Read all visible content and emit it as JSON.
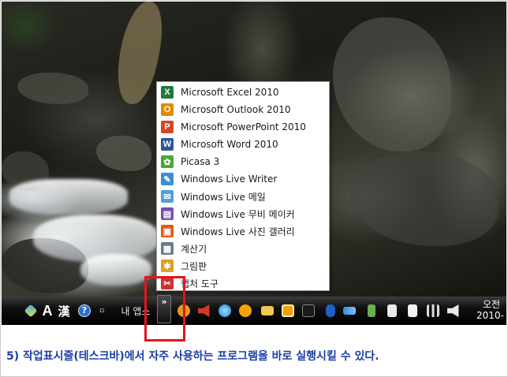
{
  "popup_menu": {
    "items": [
      {
        "label": "Microsoft Excel 2010",
        "icon": "excel-icon",
        "color": "#1f7a3d",
        "glyph": "X"
      },
      {
        "label": "Microsoft Outlook 2010",
        "icon": "outlook-icon",
        "color": "#e08a00",
        "glyph": "O"
      },
      {
        "label": "Microsoft PowerPoint 2010",
        "icon": "powerpoint-icon",
        "color": "#d24726",
        "glyph": "P"
      },
      {
        "label": "Microsoft Word 2010",
        "icon": "word-icon",
        "color": "#2b5797",
        "glyph": "W"
      },
      {
        "label": "Picasa 3",
        "icon": "picasa-icon",
        "color": "#4aa83b",
        "glyph": "✿"
      },
      {
        "label": "Windows Live Writer",
        "icon": "writer-icon",
        "color": "#3a8fd6",
        "glyph": "✎"
      },
      {
        "label": "Windows Live 메일",
        "icon": "live-mail-icon",
        "color": "#4ea1e0",
        "glyph": "✉"
      },
      {
        "label": "Windows Live 무비 메이커",
        "icon": "movie-maker-icon",
        "color": "#7a4fb0",
        "glyph": "▤"
      },
      {
        "label": "Windows Live 사진 갤러리",
        "icon": "photo-gallery-icon",
        "color": "#e05a1a",
        "glyph": "▣"
      },
      {
        "label": "계산기",
        "icon": "calculator-icon",
        "color": "#6b7a8a",
        "glyph": "▦"
      },
      {
        "label": "그림판",
        "icon": "paint-icon",
        "color": "#d9a02b",
        "glyph": "✱"
      },
      {
        "label": "캡처 도구",
        "icon": "snipping-tool-icon",
        "color": "#c33",
        "glyph": "✂"
      }
    ]
  },
  "taskbar": {
    "lang_a": "A",
    "lang_han": "漢",
    "help": "?",
    "apps_label": "내 앱스",
    "chevron": "»",
    "clock_line1": "오전",
    "clock_line2": "2010-"
  },
  "tray_icons": [
    "tools-icon",
    "orange-circle-icon",
    "speaker-icon",
    "blue-swirl-icon",
    "update-icon",
    "mail-icon",
    "outlook-tray-icon",
    "camera-icon",
    "bluetooth-icon",
    "sync-icon",
    "usb-icon",
    "flag-icon",
    "network-icon",
    "volume-icon"
  ],
  "caption": "5) 작업표시줄(테스크바)에서 자주 사용하는 프로그램을 바로 실행시킬 수 있다.",
  "colors": {
    "caption": "#1a3ea8",
    "highlight": "#e3141c"
  }
}
